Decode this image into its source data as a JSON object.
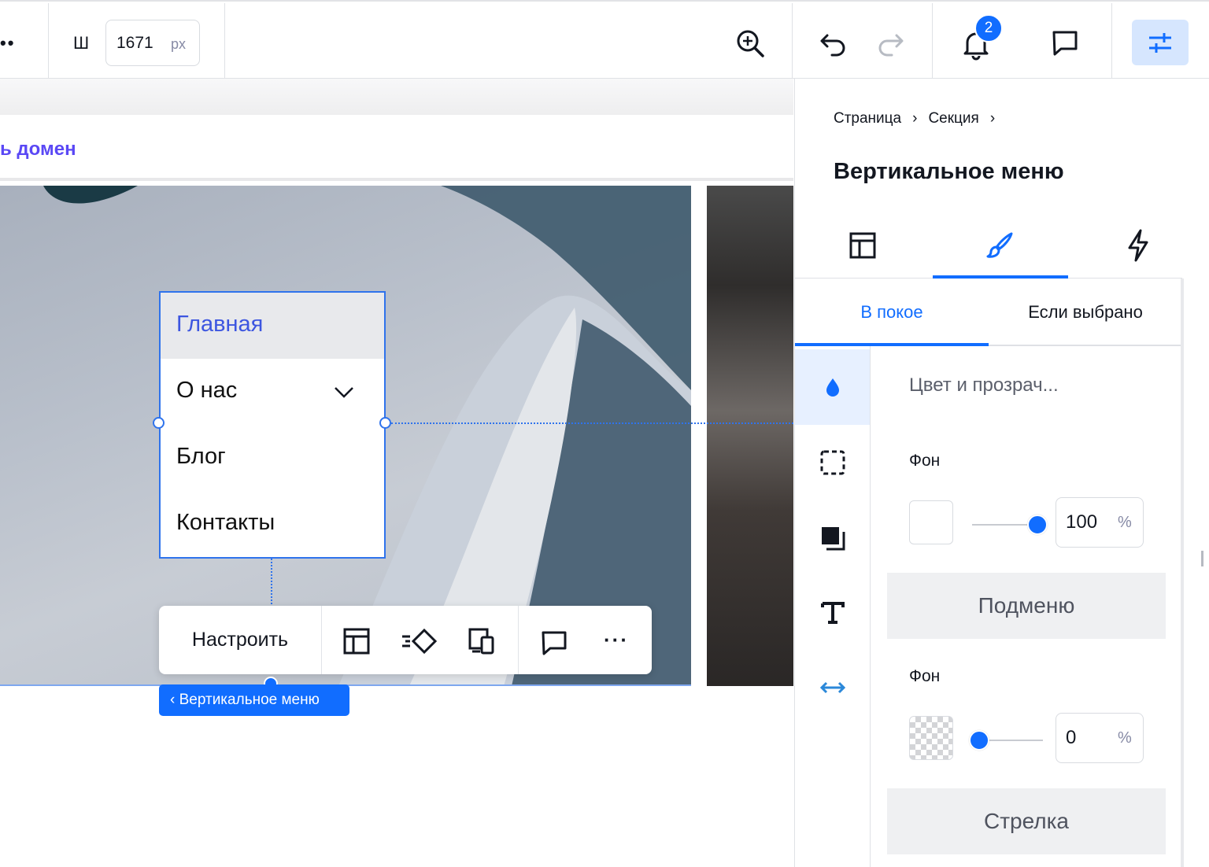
{
  "toolbar": {
    "more_glyph": "••",
    "width_label": "Ш",
    "width_value": "1671",
    "width_unit": "px",
    "zoom_icon": "zoom-in-icon",
    "undo_icon": "undo-icon",
    "redo_icon": "redo-icon",
    "notifications_count": "2",
    "accent": "#116dff"
  },
  "stage": {
    "domain_link": "ь домен",
    "menu_items": [
      {
        "label": "Главная",
        "selected": true
      },
      {
        "label": "О нас",
        "has_submenu": true
      },
      {
        "label": "Блог"
      },
      {
        "label": "Контакты"
      }
    ],
    "action_bar": {
      "customize_label": "Настроить",
      "more_glyph": "···"
    },
    "element_tag": "‹ Вертикальное меню"
  },
  "panel": {
    "breadcrumb": [
      "Страница",
      "Секция"
    ],
    "breadcrumb_sep": "›",
    "title": "Вертикальное меню",
    "main_tabs": [
      "layout-icon",
      "design-brush-icon",
      "interactions-bolt-icon"
    ],
    "active_main_tab": 1,
    "state_tabs": [
      "В покое",
      "Если выбрано"
    ],
    "active_state_tab": 0,
    "section_title": "Цвет и прозрач...",
    "fields": [
      {
        "label": "Фон",
        "opacity_value": "100",
        "unit": "%",
        "opacity": 1.0,
        "swatch_color": "#ffffff"
      },
      {
        "label": "Фон",
        "opacity_value": "0",
        "unit": "%",
        "opacity": 0.0,
        "swatch_color": "transparent"
      }
    ],
    "groups": [
      "Подменю",
      "Стрелка"
    ]
  }
}
